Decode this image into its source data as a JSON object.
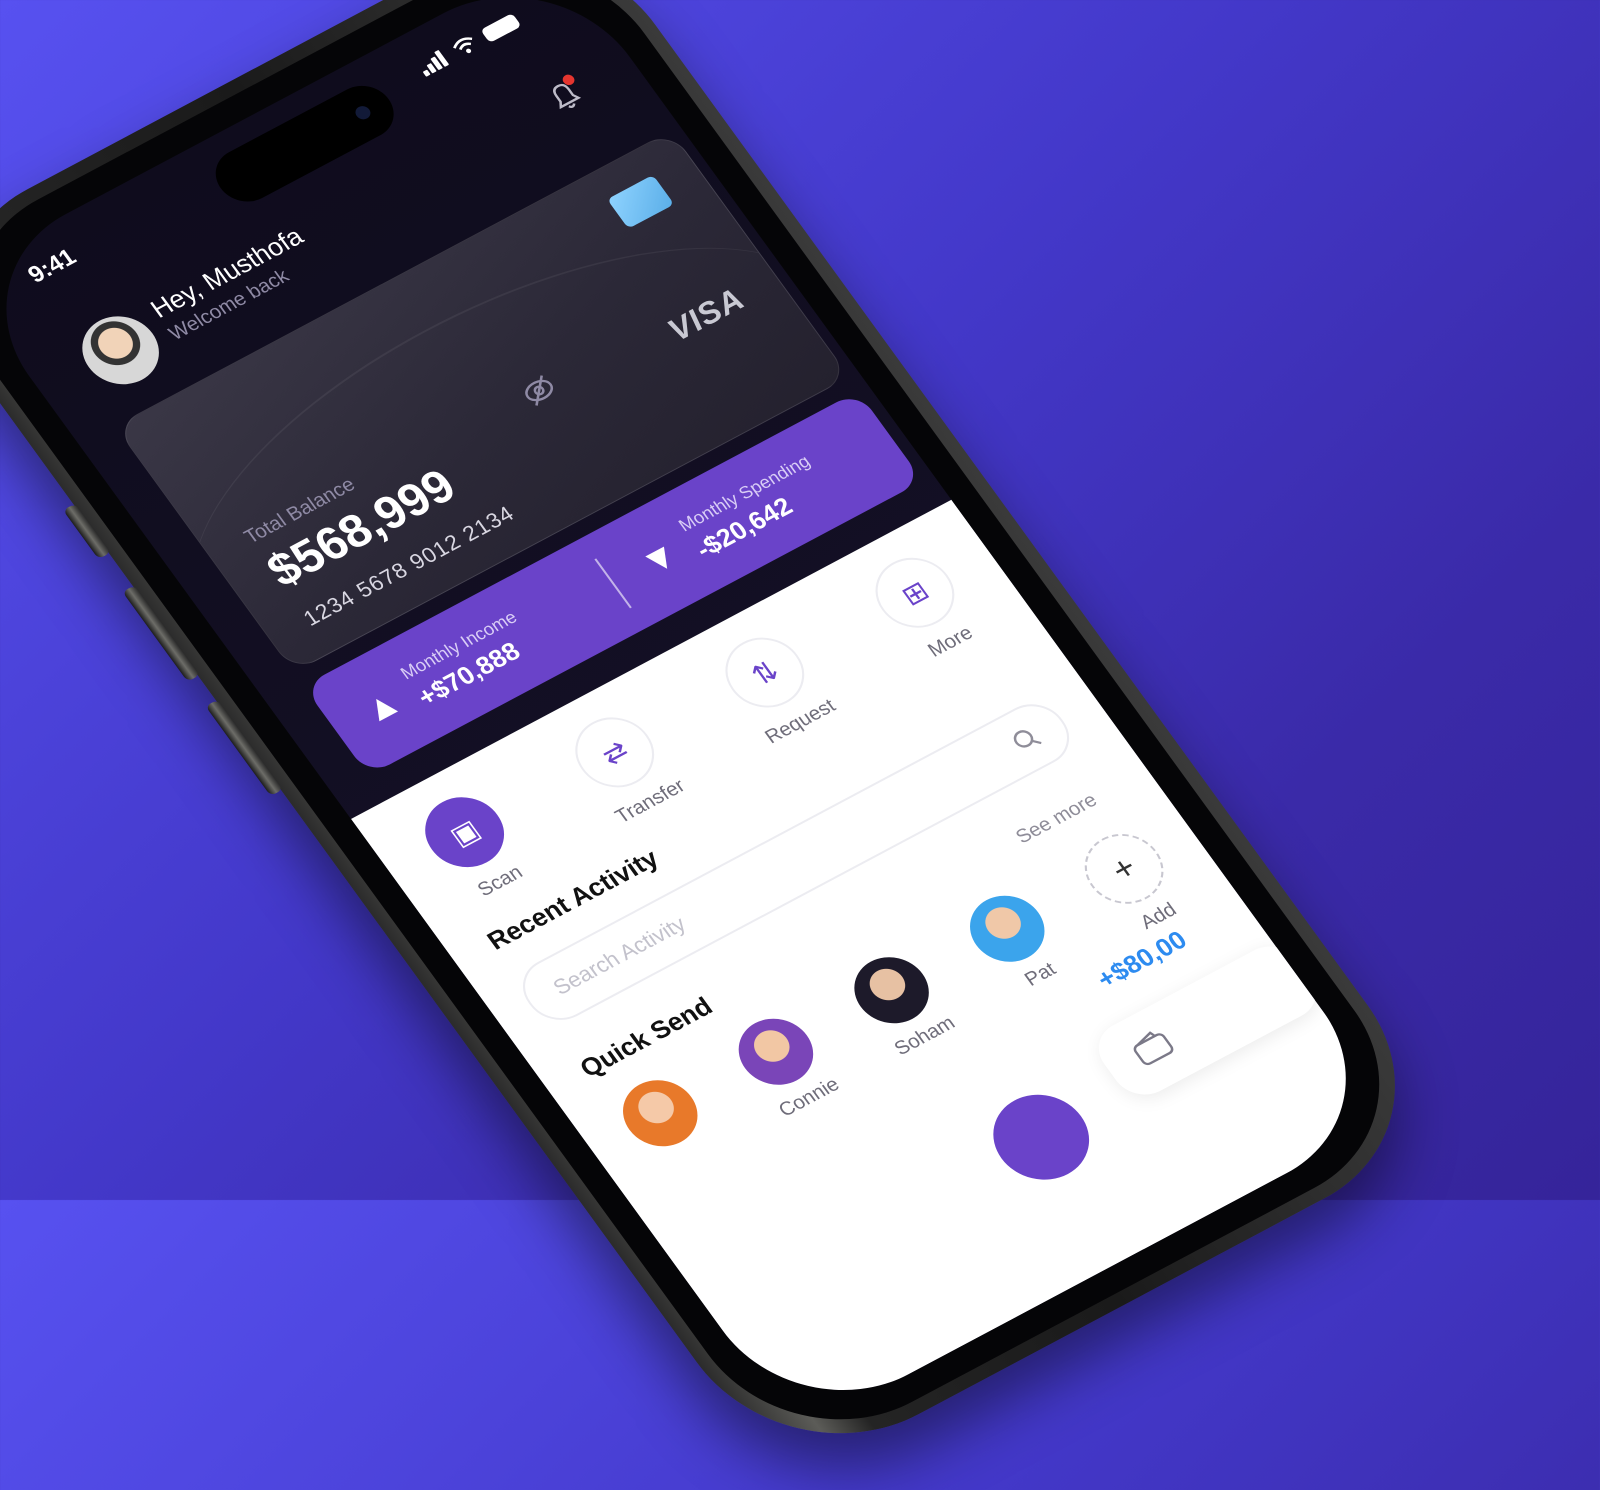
{
  "status": {
    "time": "9:41"
  },
  "header": {
    "greeting": "Hey, Musthofa",
    "subtitle": "Welcome back"
  },
  "card": {
    "brand": "VISA",
    "balance_label": "Total Balance",
    "balance": "$568,999",
    "number": "1234 5678 9012 2134"
  },
  "stats": {
    "income_label": "Monthly Income",
    "income_value": "+$70,888",
    "spending_label": "Monthly Spending",
    "spending_value": "-$20,642"
  },
  "actions": [
    {
      "label": "Scan",
      "icon": "scan-icon"
    },
    {
      "label": "Transfer",
      "icon": "transfer-icon"
    },
    {
      "label": "Request",
      "icon": "request-icon"
    },
    {
      "label": "More",
      "icon": "grid-icon"
    }
  ],
  "recent_activity": {
    "title": "Recent Activity",
    "search_placeholder": "Search Activity",
    "amount": "+$80,00"
  },
  "quick_send": {
    "title": "Quick Send",
    "see_more": "See more",
    "contacts": [
      {
        "name": ""
      },
      {
        "name": "Connie"
      },
      {
        "name": "Soham"
      },
      {
        "name": "Pat"
      },
      {
        "name": "Add"
      }
    ]
  },
  "colors": {
    "accent": "#6a43c9",
    "positive": "#2d8bf0",
    "background_start": "#5751f0",
    "background_end": "#35249a"
  }
}
